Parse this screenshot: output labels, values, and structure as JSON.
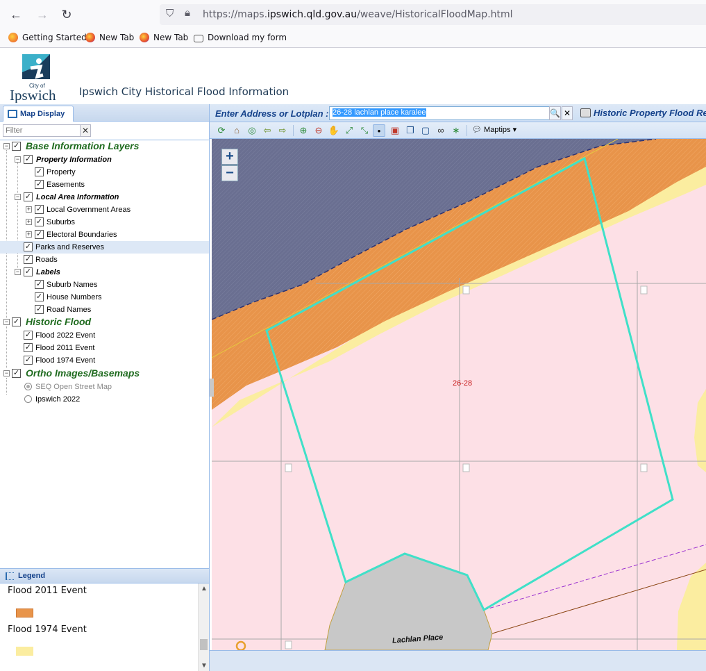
{
  "browser": {
    "url_prefix": "https://maps.",
    "url_domain": "ipswich.qld.gov.au",
    "url_path": "/weave/HistoricalFloodMap.html",
    "bookmarks": [
      {
        "label": "Getting Started"
      },
      {
        "label": "New Tab"
      },
      {
        "label": "New Tab"
      },
      {
        "label": "Download my form"
      }
    ]
  },
  "app": {
    "logo_small": "City of",
    "logo_text": "Ipswich",
    "title": "Ipswich City Historical Flood Information"
  },
  "left_panel": {
    "tab_label": "Map Display",
    "filter_placeholder": "Filter",
    "clear_label": "✕"
  },
  "tree": {
    "base_info": "Base Information Layers",
    "property_info": "Property Information",
    "property": "Property",
    "easements": "Easements",
    "local_area": "Local Area Information",
    "lga": "Local Government Areas",
    "suburbs": "Suburbs",
    "electoral": "Electoral Boundaries",
    "parks": "Parks and Reserves",
    "roads": "Roads",
    "labels": "Labels",
    "suburb_names": "Suburb Names",
    "house_numbers": "House Numbers",
    "road_names": "Road Names",
    "historic_flood": "Historic Flood",
    "flood_2022": "Flood 2022 Event",
    "flood_2011": "Flood 2011 Event",
    "flood_1974": "Flood 1974 Event",
    "ortho": "Ortho Images/Basemaps",
    "seq_osm": "SEQ Open Street Map",
    "ipswich_2022": "Ipswich 2022"
  },
  "legend": {
    "header": "Legend",
    "items": [
      {
        "label": "Flood 2011 Event",
        "color": "#e8944a"
      },
      {
        "label": "Flood 1974 Event",
        "color": "#fbeda0"
      }
    ]
  },
  "toolbar": {
    "address_label": "Enter Address or Lotplan :",
    "address_value": "26-28 lachlan place karalee",
    "search_icon": "🔍",
    "clear_icon": "✕",
    "report_label": "Historic Property Flood Re",
    "maptips_label": "Maptips"
  },
  "map": {
    "zoom_in": "+",
    "zoom_out": "−",
    "lot_label": "26-28",
    "road_label": "Lachlan Place",
    "colors": {
      "flood_2011": "#e8944a",
      "flood_1974": "#fbeda0",
      "flood_2022": "#6a6f91",
      "parcel_bg": "#fde0e6",
      "selected_outline": "#40e0c8",
      "road_fill": "#c8c8c8"
    }
  }
}
